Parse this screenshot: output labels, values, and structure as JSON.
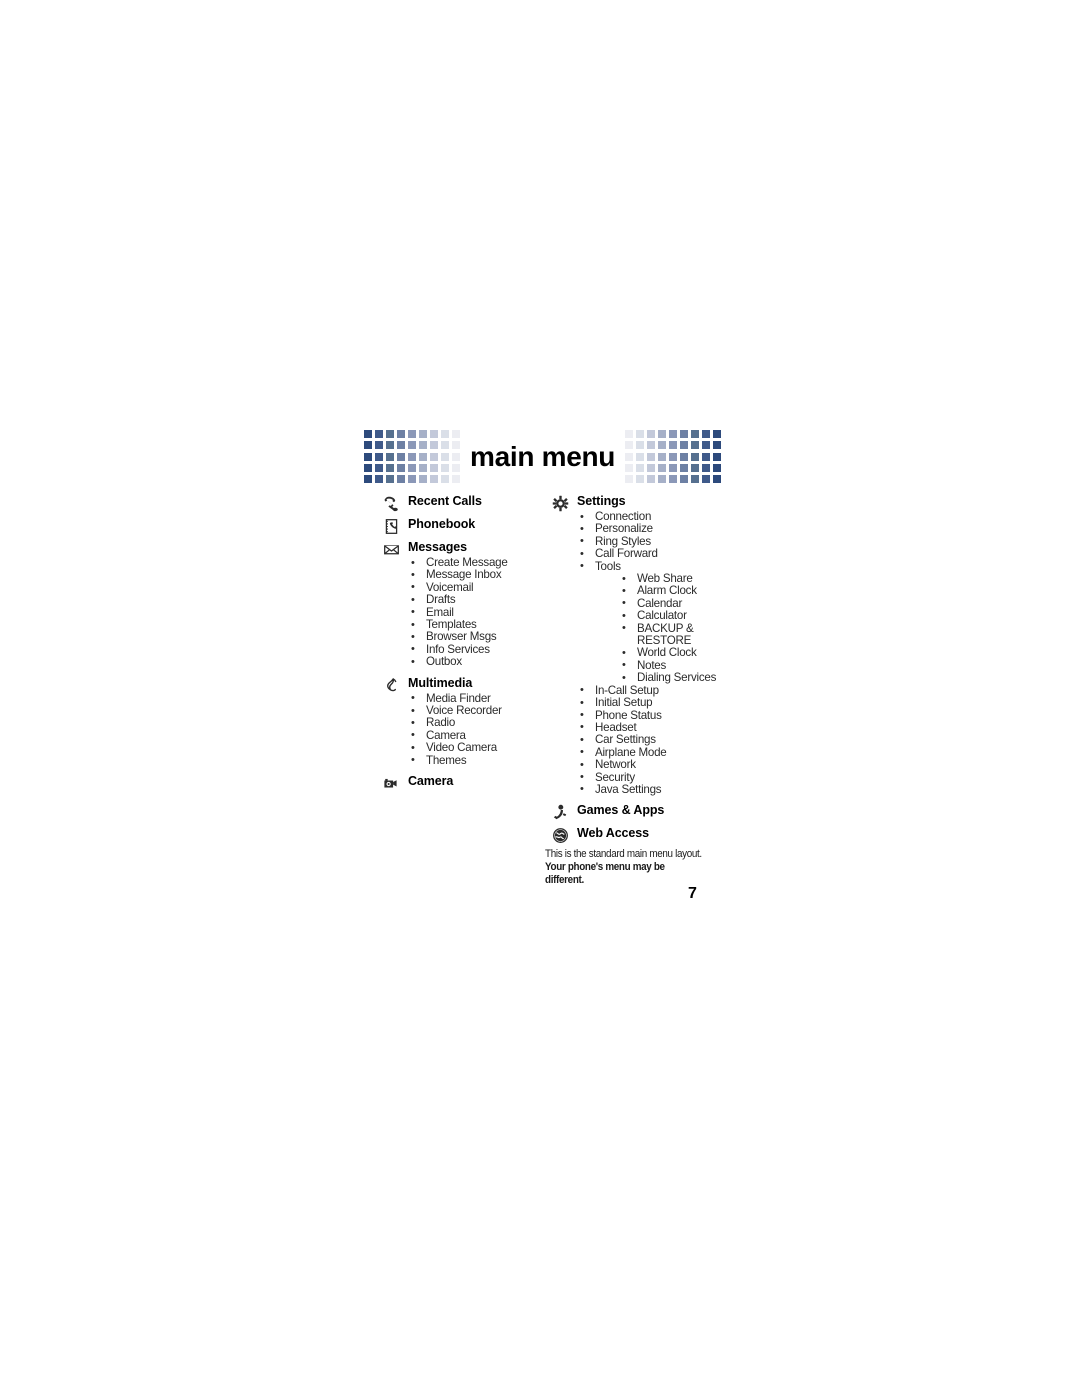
{
  "banner": {
    "title": "main menu",
    "accent_color": "#2d4a7c",
    "pattern_colors": [
      "#2d4a7c",
      "#3f5a8a",
      "#56708f",
      "#6d80a4",
      "#8b98b8",
      "#a6b0c8",
      "#c3c9da",
      "#dadfe8",
      "#ecedf2"
    ]
  },
  "columns": {
    "left": [
      {
        "icon": "phone-handset-icon",
        "label": "Recent Calls",
        "items": []
      },
      {
        "icon": "phonebook-icon",
        "label": "Phonebook",
        "items": []
      },
      {
        "icon": "envelope-icon",
        "label": "Messages",
        "items": [
          {
            "label": "Create Message"
          },
          {
            "label": "Message Inbox"
          },
          {
            "label": "Voicemail"
          },
          {
            "label": "Drafts"
          },
          {
            "label": "Email"
          },
          {
            "label": "Templates"
          },
          {
            "label": "Browser Msgs"
          },
          {
            "label": "Info Services"
          },
          {
            "label": "Outbox"
          }
        ]
      },
      {
        "icon": "music-note-icon",
        "label": "Multimedia",
        "items": [
          {
            "label": "Media Finder"
          },
          {
            "label": "Voice Recorder"
          },
          {
            "label": "Radio"
          },
          {
            "label": "Camera"
          },
          {
            "label": "Video Camera"
          },
          {
            "label": "Themes"
          }
        ]
      },
      {
        "icon": "camera-icon",
        "label": "Camera",
        "items": []
      }
    ],
    "right": [
      {
        "icon": "gear-icon",
        "label": "Settings",
        "items": [
          {
            "label": "Connection"
          },
          {
            "label": "Personalize"
          },
          {
            "label": "Ring Styles"
          },
          {
            "label": "Call Forward"
          },
          {
            "label": "Tools",
            "children": [
              {
                "label": "Web Share"
              },
              {
                "label": "Alarm Clock"
              },
              {
                "label": "Calendar"
              },
              {
                "label": "Calculator"
              },
              {
                "label": "BACKUP & RESTORE"
              },
              {
                "label": "World Clock"
              },
              {
                "label": "Notes"
              },
              {
                "label": "Dialing Services"
              }
            ]
          },
          {
            "label": "In-Call Setup"
          },
          {
            "label": "Initial Setup"
          },
          {
            "label": "Phone Status"
          },
          {
            "label": "Headset"
          },
          {
            "label": "Car Settings"
          },
          {
            "label": "Airplane Mode"
          },
          {
            "label": "Network"
          },
          {
            "label": "Security"
          },
          {
            "label": "Java Settings"
          }
        ]
      },
      {
        "icon": "games-apps-icon",
        "label": "Games & Apps",
        "items": []
      },
      {
        "icon": "globe-icon",
        "label": "Web Access",
        "items": []
      }
    ]
  },
  "footnote": {
    "line1": "This is the standard main menu layout.",
    "line2": "Your phone's menu may be",
    "line3": "different."
  },
  "page_number": "7"
}
